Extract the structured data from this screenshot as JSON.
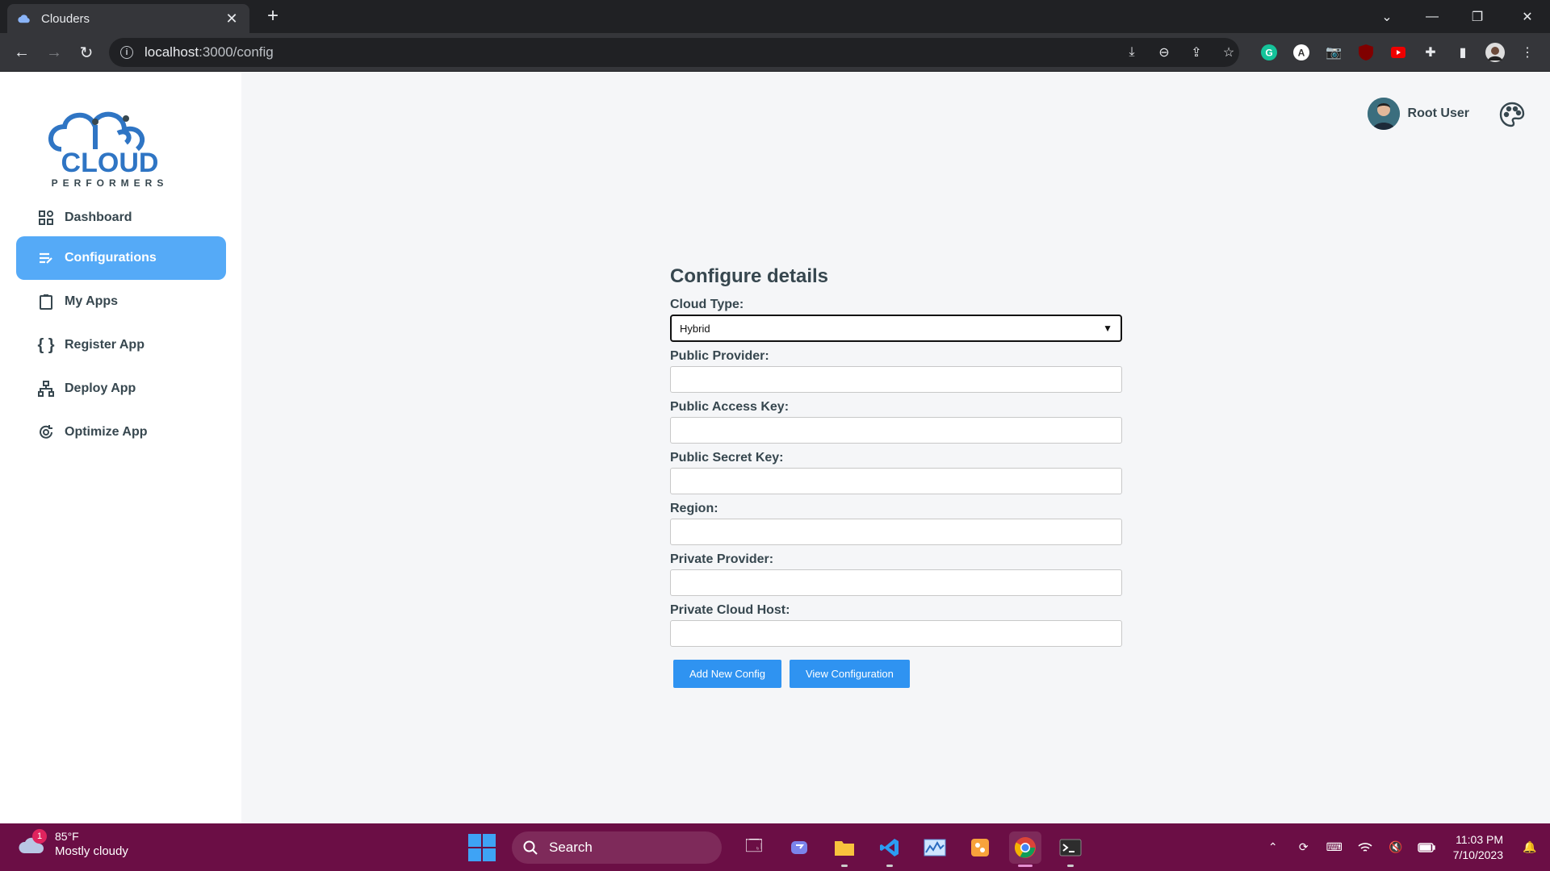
{
  "browser": {
    "tab_title": "Clouders",
    "url_host": "localhost",
    "url_path": ":3000/config"
  },
  "app": {
    "logo": {
      "line1": "CLOUD",
      "line2": "PERFORMERS"
    },
    "sidebar": {
      "items": [
        {
          "label": "Dashboard",
          "icon": "grid-icon",
          "active": false
        },
        {
          "label": "Configurations",
          "icon": "list-edit-icon",
          "active": true
        },
        {
          "label": "My Apps",
          "icon": "clipboard-icon",
          "active": false
        },
        {
          "label": "Register App",
          "icon": "braces-icon",
          "active": false
        },
        {
          "label": "Deploy App",
          "icon": "hierarchy-icon",
          "active": false
        },
        {
          "label": "Optimize App",
          "icon": "optimize-icon",
          "active": false
        }
      ]
    },
    "header": {
      "user_name": "Root User"
    },
    "form": {
      "title": "Configure details",
      "cloud_type_label": "Cloud Type:",
      "cloud_type_value": "Hybrid",
      "fields": [
        {
          "label": "Public Provider:",
          "value": ""
        },
        {
          "label": "Public Access Key:",
          "value": ""
        },
        {
          "label": "Public Secret Key:",
          "value": ""
        },
        {
          "label": "Region:",
          "value": ""
        },
        {
          "label": "Private Provider:",
          "value": ""
        },
        {
          "label": "Private Cloud Host:",
          "value": ""
        }
      ],
      "add_button": "Add New Config",
      "view_button": "View Configuration"
    },
    "colors": {
      "active_nav": "#55aaf7",
      "button": "#2f93f1",
      "taskbar": "#6b0e45"
    }
  },
  "taskbar": {
    "weather_badge": "1",
    "weather_temp": "85°F",
    "weather_condition": "Mostly cloudy",
    "search_label": "Search",
    "time": "11:03 PM",
    "date": "7/10/2023"
  }
}
